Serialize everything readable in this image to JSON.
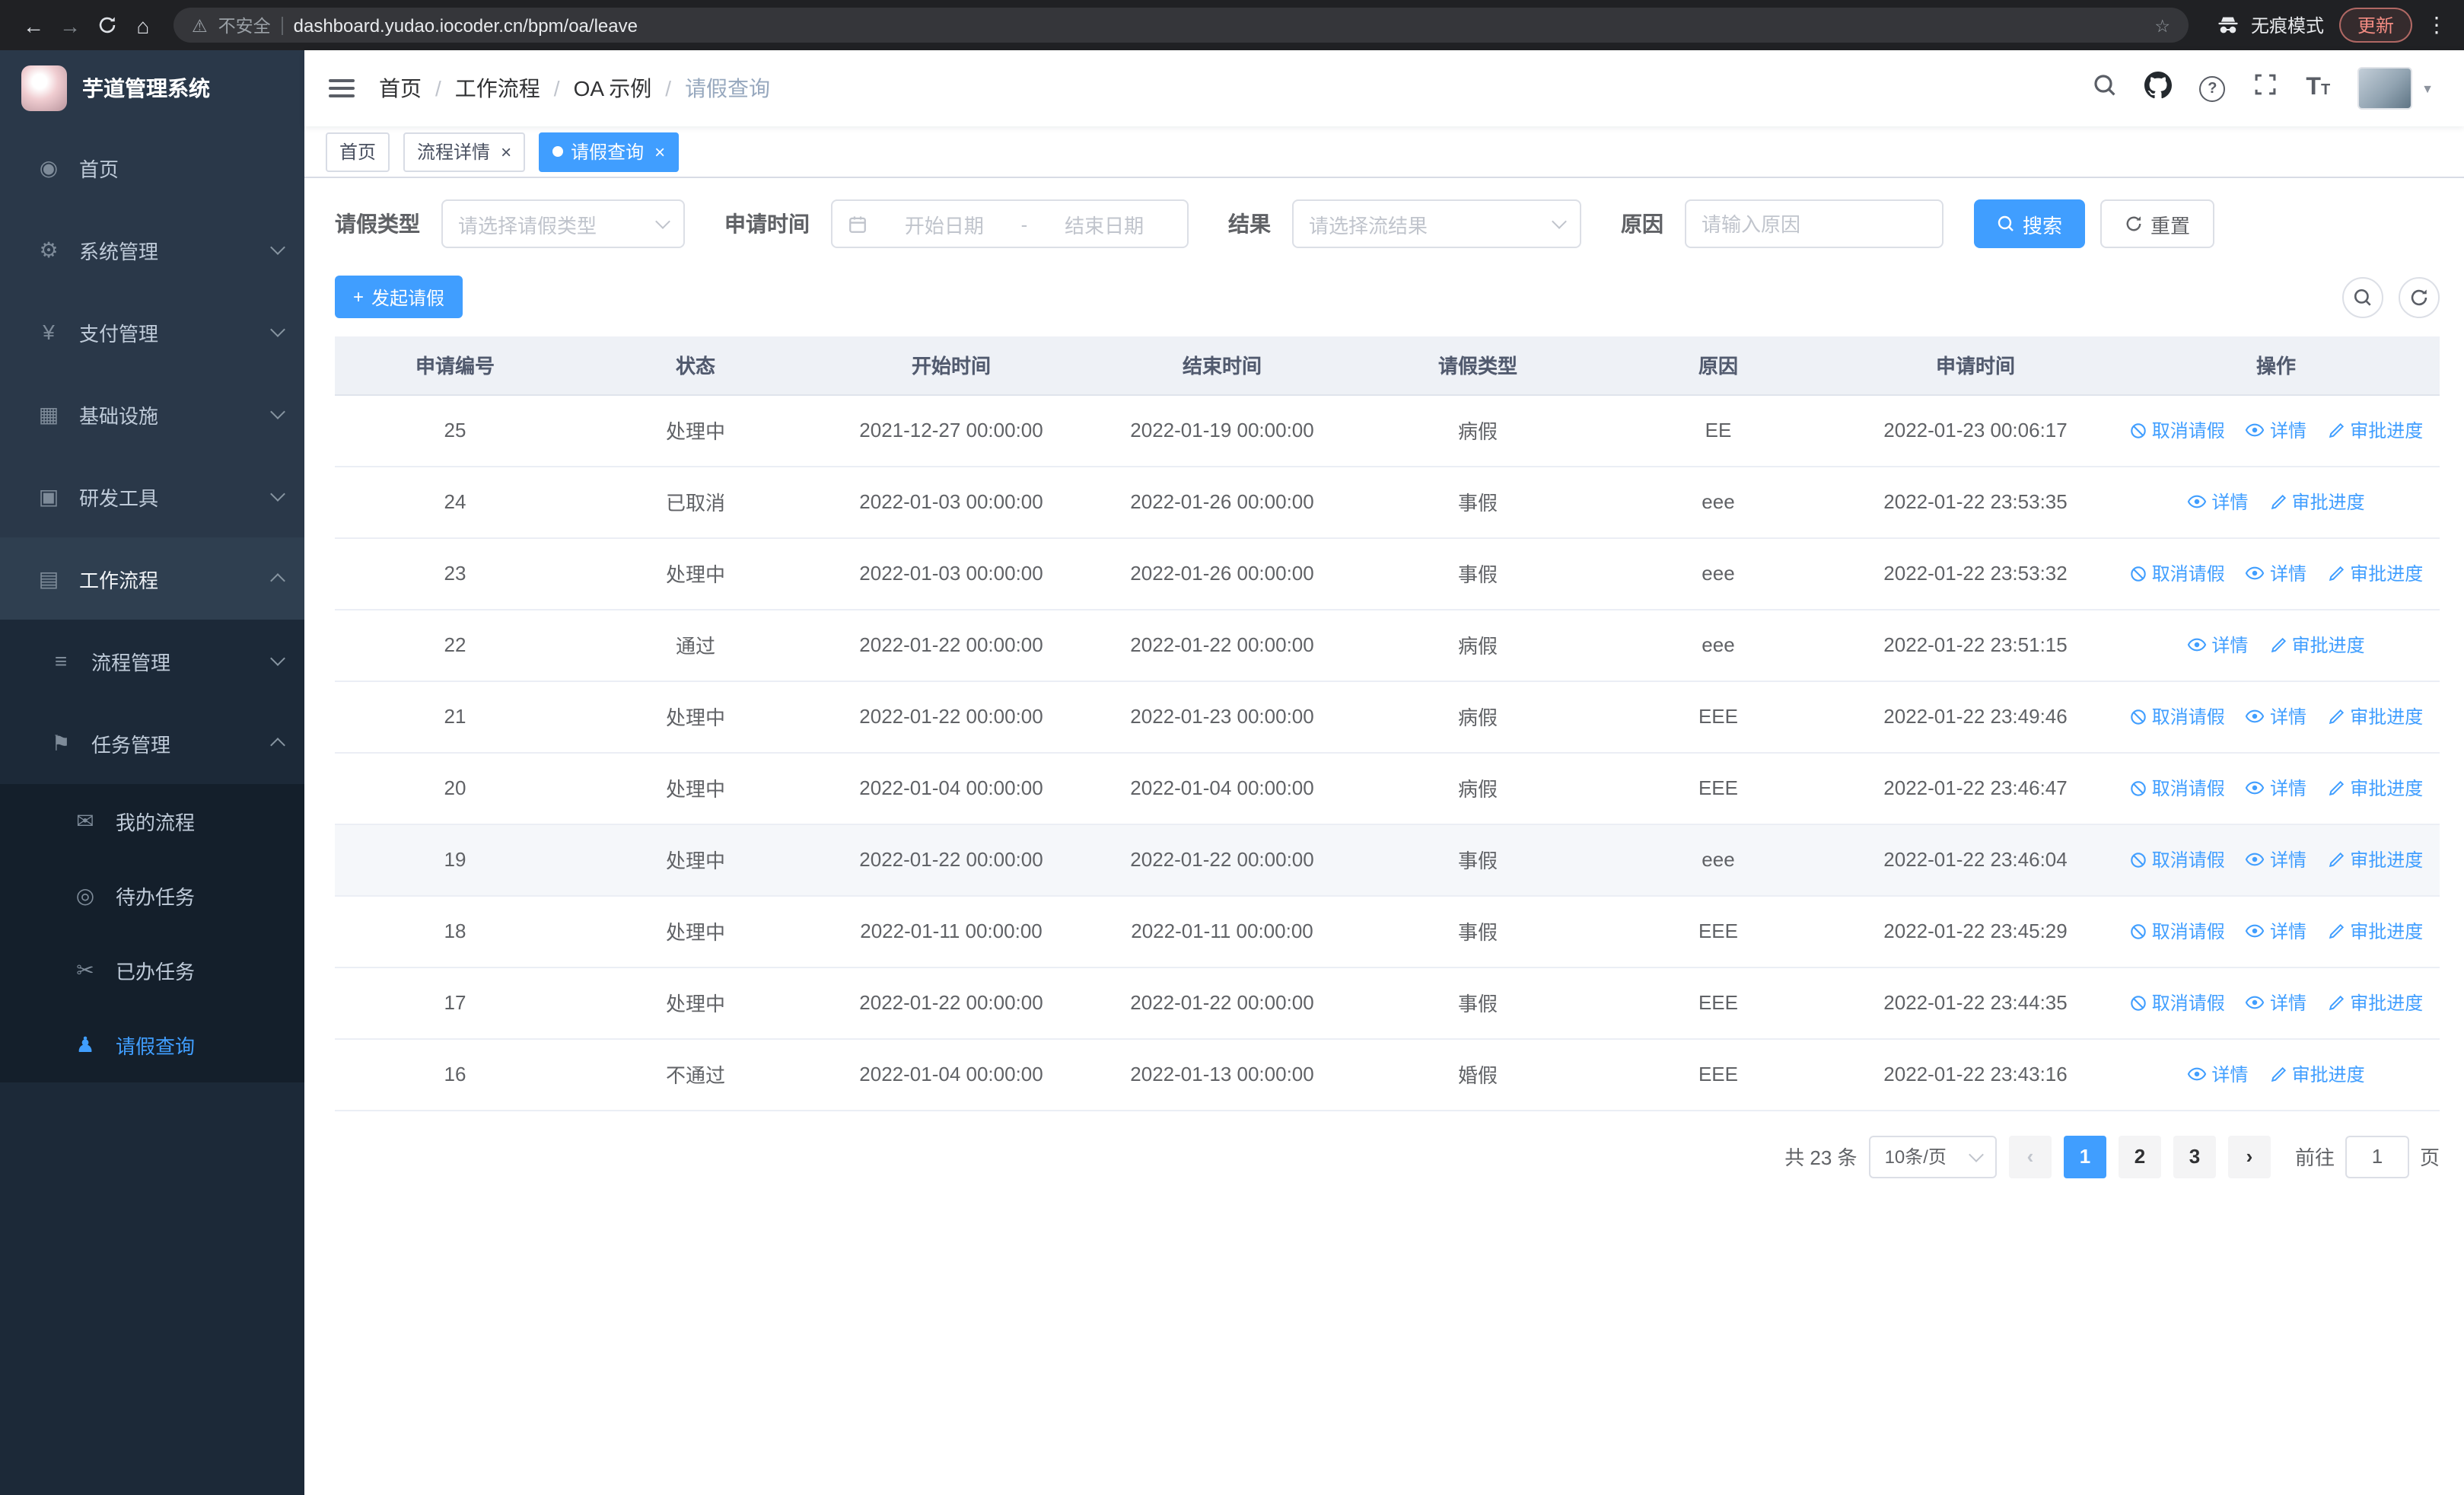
{
  "browser": {
    "security_label": "不安全",
    "url": "dashboard.yudao.iocoder.cn/bpm/oa/leave",
    "incognito_label": "无痕模式",
    "update_label": "更新"
  },
  "icons": {
    "back": "←",
    "forward": "→",
    "home": "⌂",
    "warning": "⚠",
    "star": "☆",
    "menu": "⋮",
    "dashboard": "◉",
    "system": "⚙",
    "payment": "¥",
    "infra": "▦",
    "devtools": "▣",
    "workflow": "▤",
    "process": "≡",
    "task": "⚑",
    "my_process": "✉",
    "todo": "◎",
    "done": "✂",
    "leave": "♟",
    "caret": "▼",
    "plus": "+",
    "prev": "‹",
    "next": "›"
  },
  "sidebar": {
    "logo_title": "芋道管理系统",
    "items": [
      {
        "label": "首页"
      },
      {
        "label": "系统管理"
      },
      {
        "label": "支付管理"
      },
      {
        "label": "基础设施"
      },
      {
        "label": "研发工具"
      },
      {
        "label": "工作流程"
      }
    ],
    "workflow_children": [
      {
        "label": "流程管理"
      },
      {
        "label": "任务管理"
      }
    ],
    "task_children": [
      {
        "label": "我的流程"
      },
      {
        "label": "待办任务"
      },
      {
        "label": "已办任务"
      },
      {
        "label": "请假查询"
      }
    ]
  },
  "header": {
    "breadcrumb": [
      "首页",
      "工作流程",
      "OA 示例",
      "请假查询"
    ]
  },
  "tabs": [
    {
      "label": "首页"
    },
    {
      "label": "流程详情"
    },
    {
      "label": "请假查询"
    }
  ],
  "filters": {
    "leave_type_label": "请假类型",
    "leave_type_placeholder": "请选择请假类型",
    "apply_time_label": "申请时间",
    "start_date_placeholder": "开始日期",
    "range_separator": "-",
    "end_date_placeholder": "结束日期",
    "result_label": "结果",
    "result_placeholder": "请选择流结果",
    "reason_label": "原因",
    "reason_placeholder": "请输入原因",
    "search_label": "搜索",
    "reset_label": "重置"
  },
  "toolbar": {
    "create_label": "发起请假"
  },
  "table": {
    "columns": [
      "申请编号",
      "状态",
      "开始时间",
      "结束时间",
      "请假类型",
      "原因",
      "申请时间",
      "操作"
    ],
    "ops": {
      "cancel": "取消请假",
      "detail": "详情",
      "progress": "审批进度"
    },
    "rows": [
      {
        "id": "25",
        "status": "处理中",
        "start": "2021-12-27 00:00:00",
        "end": "2022-01-19 00:00:00",
        "type": "病假",
        "reason": "EE",
        "applied": "2022-01-23 00:06:17",
        "cancellable": true
      },
      {
        "id": "24",
        "status": "已取消",
        "start": "2022-01-03 00:00:00",
        "end": "2022-01-26 00:00:00",
        "type": "事假",
        "reason": "eee",
        "applied": "2022-01-22 23:53:35",
        "cancellable": false
      },
      {
        "id": "23",
        "status": "处理中",
        "start": "2022-01-03 00:00:00",
        "end": "2022-01-26 00:00:00",
        "type": "事假",
        "reason": "eee",
        "applied": "2022-01-22 23:53:32",
        "cancellable": true
      },
      {
        "id": "22",
        "status": "通过",
        "start": "2022-01-22 00:00:00",
        "end": "2022-01-22 00:00:00",
        "type": "病假",
        "reason": "eee",
        "applied": "2022-01-22 23:51:15",
        "cancellable": false
      },
      {
        "id": "21",
        "status": "处理中",
        "start": "2022-01-22 00:00:00",
        "end": "2022-01-23 00:00:00",
        "type": "病假",
        "reason": "EEE",
        "applied": "2022-01-22 23:49:46",
        "cancellable": true
      },
      {
        "id": "20",
        "status": "处理中",
        "start": "2022-01-04 00:00:00",
        "end": "2022-01-04 00:00:00",
        "type": "病假",
        "reason": "EEE",
        "applied": "2022-01-22 23:46:47",
        "cancellable": true
      },
      {
        "id": "19",
        "status": "处理中",
        "start": "2022-01-22 00:00:00",
        "end": "2022-01-22 00:00:00",
        "type": "事假",
        "reason": "eee",
        "applied": "2022-01-22 23:46:04",
        "cancellable": true,
        "highlighted": true
      },
      {
        "id": "18",
        "status": "处理中",
        "start": "2022-01-11 00:00:00",
        "end": "2022-01-11 00:00:00",
        "type": "事假",
        "reason": "EEE",
        "applied": "2022-01-22 23:45:29",
        "cancellable": true
      },
      {
        "id": "17",
        "status": "处理中",
        "start": "2022-01-22 00:00:00",
        "end": "2022-01-22 00:00:00",
        "type": "事假",
        "reason": "EEE",
        "applied": "2022-01-22 23:44:35",
        "cancellable": true
      },
      {
        "id": "16",
        "status": "不通过",
        "start": "2022-01-04 00:00:00",
        "end": "2022-01-13 00:00:00",
        "type": "婚假",
        "reason": "EEE",
        "applied": "2022-01-22 23:43:16",
        "cancellable": false
      }
    ]
  },
  "pagination": {
    "total": "共 23 条",
    "page_size": "10条/页",
    "pages": [
      "1",
      "2",
      "3"
    ],
    "goto_label": "前往",
    "goto_value": "1",
    "goto_suffix": "页"
  },
  "colors": {
    "primary": "#409eff",
    "sidebar_dark": "#1c2938",
    "danger": "#f28b82"
  }
}
